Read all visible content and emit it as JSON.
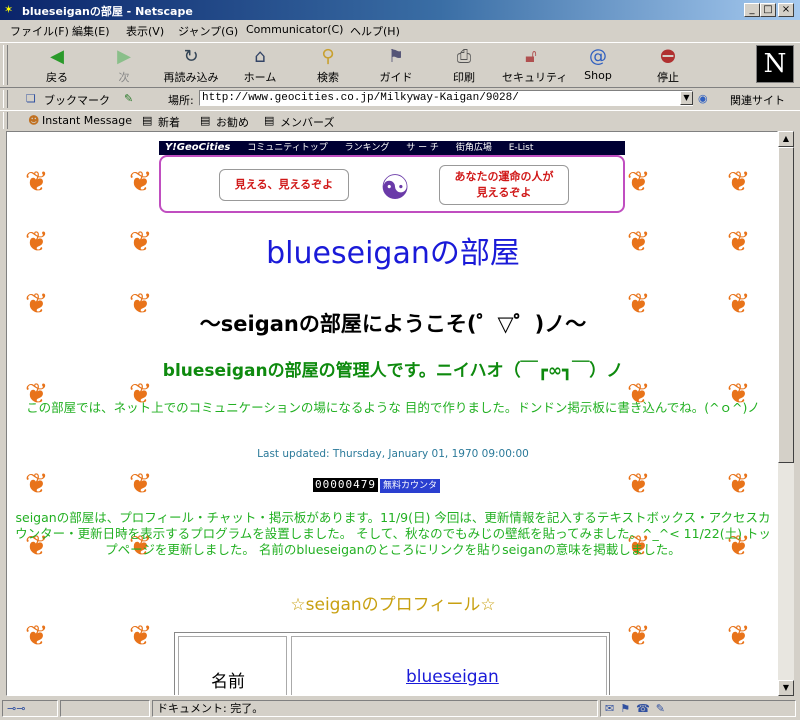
{
  "window": {
    "title": "blueseiganの部屋 - Netscape",
    "icon": "netscape-stars-icon",
    "minimize_label": "_",
    "maximize_label": "□",
    "close_label": "×"
  },
  "menu": [
    "ファイル(F)",
    "編集(E)",
    "表示(V)",
    "ジャンプ(G)",
    "Communicator(C)",
    "ヘルプ(H)"
  ],
  "toolbar": {
    "back": "戻る",
    "forward": "次",
    "reload": "再読み込み",
    "home": "ホーム",
    "search": "検索",
    "guide": "ガイド",
    "print": "印刷",
    "security": "セキュリティ",
    "shop": "Shop",
    "stop": "停止",
    "logo": "N"
  },
  "location": {
    "bookmarks": "ブックマーク",
    "label": "場所:",
    "url": "http://www.geocities.co.jp/Milkyway-Kaigan/9028/",
    "related": "関連サイト"
  },
  "personal": [
    "Instant Message",
    "新着",
    "お勧め",
    "メンバーズ"
  ],
  "geocities_bar": {
    "logo": "Y!GeoCities",
    "links": [
      "コミュニティトップ",
      "ランキング",
      "サ ー チ",
      "街角広場",
      "E-List"
    ]
  },
  "ad": {
    "left_text": "見える、見えるぞよ",
    "right_text": "あなたの運命の人が\n見えるぞよ"
  },
  "content": {
    "title": "blueseiganの部屋",
    "welcome": "～seiganの部屋にようこそ(゜▽゜)ノ～",
    "admin": "blueseiganの部屋の管理人です。ニイハオ（￣┏∞┓￣）ノ",
    "intro": "この部屋では、ネット上でのコミュニケーションの場になるような 目的で作りました。ドンドン掲示板に書き込んでね。(^ｏ^)ノ",
    "last_updated": "Last updated: Thursday, January 01, 1970 09:00:00",
    "counter_digits": "00000479",
    "counter_label": "無料カウンタ",
    "news": "seiganの部屋は、プロフィール・チャット・掲示板があります。11/9(日) 今回は、更新情報を記入するテキストボックス・アクセスカウンター・更新日時を表示するプログラムを設置しました。 そして、秋なのでもみじの壁紙を貼ってみました。^_^< 11/22(土) トップページを更新しました。 名前のblueseiganのところにリンクを貼りseiganの意味を掲載しました。",
    "profile_heading": "☆seiganのプロフィール☆",
    "profile_rows": [
      {
        "label": "名前",
        "value": "blueseigan"
      }
    ]
  },
  "status": {
    "text": "ドキュメント: 完了。"
  },
  "colors": {
    "titlebar": "#0a246a",
    "title_blue": "#1a1ad8",
    "green_text": "#22b022",
    "admin_green": "#0e8a0e",
    "gold": "#c8a010",
    "leaf_orange": "#e8731a"
  }
}
